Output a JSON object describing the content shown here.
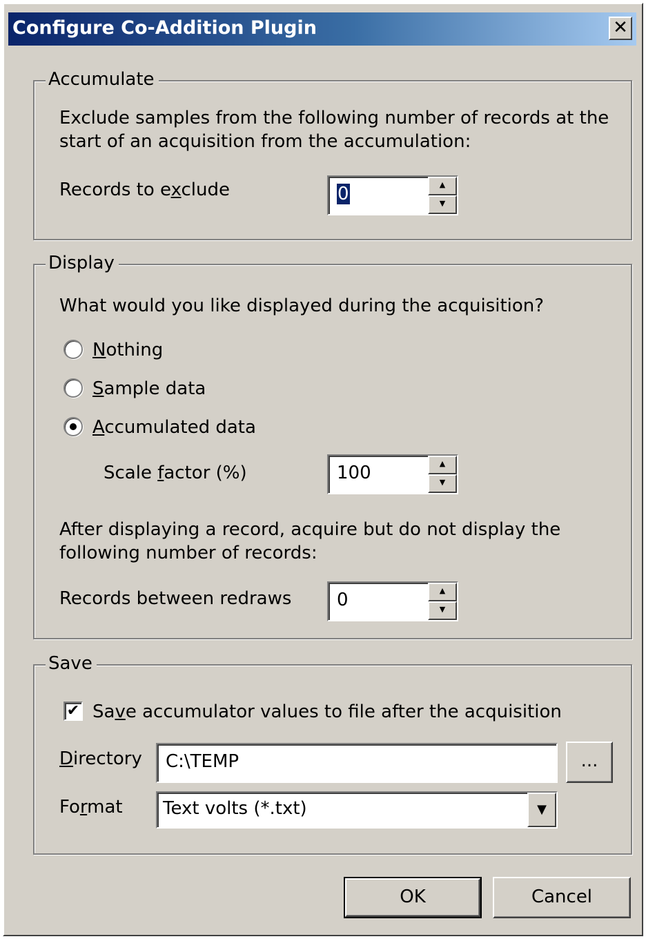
{
  "window": {
    "title": "Configure Co-Addition Plugin",
    "close_glyph": "✕"
  },
  "accumulate": {
    "legend": "Accumulate",
    "description_line1": "Exclude samples from the following number of records at the",
    "description_line2": "start of an acquisition from the accumulation:",
    "records_label": {
      "before": "Records to e",
      "accel": "x",
      "after": "clude"
    },
    "records_value": "0"
  },
  "display": {
    "legend": "Display",
    "question": "What would you like displayed during the acquisition?",
    "options": [
      {
        "accel": "N",
        "rest": "othing",
        "checked": false
      },
      {
        "accel": "S",
        "rest": "ample data",
        "checked": false
      },
      {
        "accel": "A",
        "rest": "ccumulated data",
        "checked": true
      }
    ],
    "scale_label": {
      "before": "Scale ",
      "accel": "f",
      "after": "actor (%)"
    },
    "scale_value": "100",
    "after_line1": "After displaying a record, acquire but do not display the",
    "after_line2": "following number of records:",
    "redraws_label": "Records between redraws",
    "redraws_value": "0"
  },
  "save": {
    "legend": "Save",
    "checkbox_label": {
      "before": "Sa",
      "accel": "v",
      "after": "e accumulator values to file after the acquisition"
    },
    "checkbox_checked": true,
    "directory_label": {
      "before": "",
      "accel": "D",
      "after": "irectory"
    },
    "directory_value": "C:\\TEMP",
    "browse_label": "...",
    "format_label": {
      "before": "Fo",
      "accel": "r",
      "after": "mat"
    },
    "format_value": "Text volts (*.txt)"
  },
  "buttons": {
    "ok": "OK",
    "cancel": "Cancel"
  },
  "icons": {
    "spin_up": "▲",
    "spin_down": "▼",
    "dropdown": "▼",
    "check": "✔"
  }
}
